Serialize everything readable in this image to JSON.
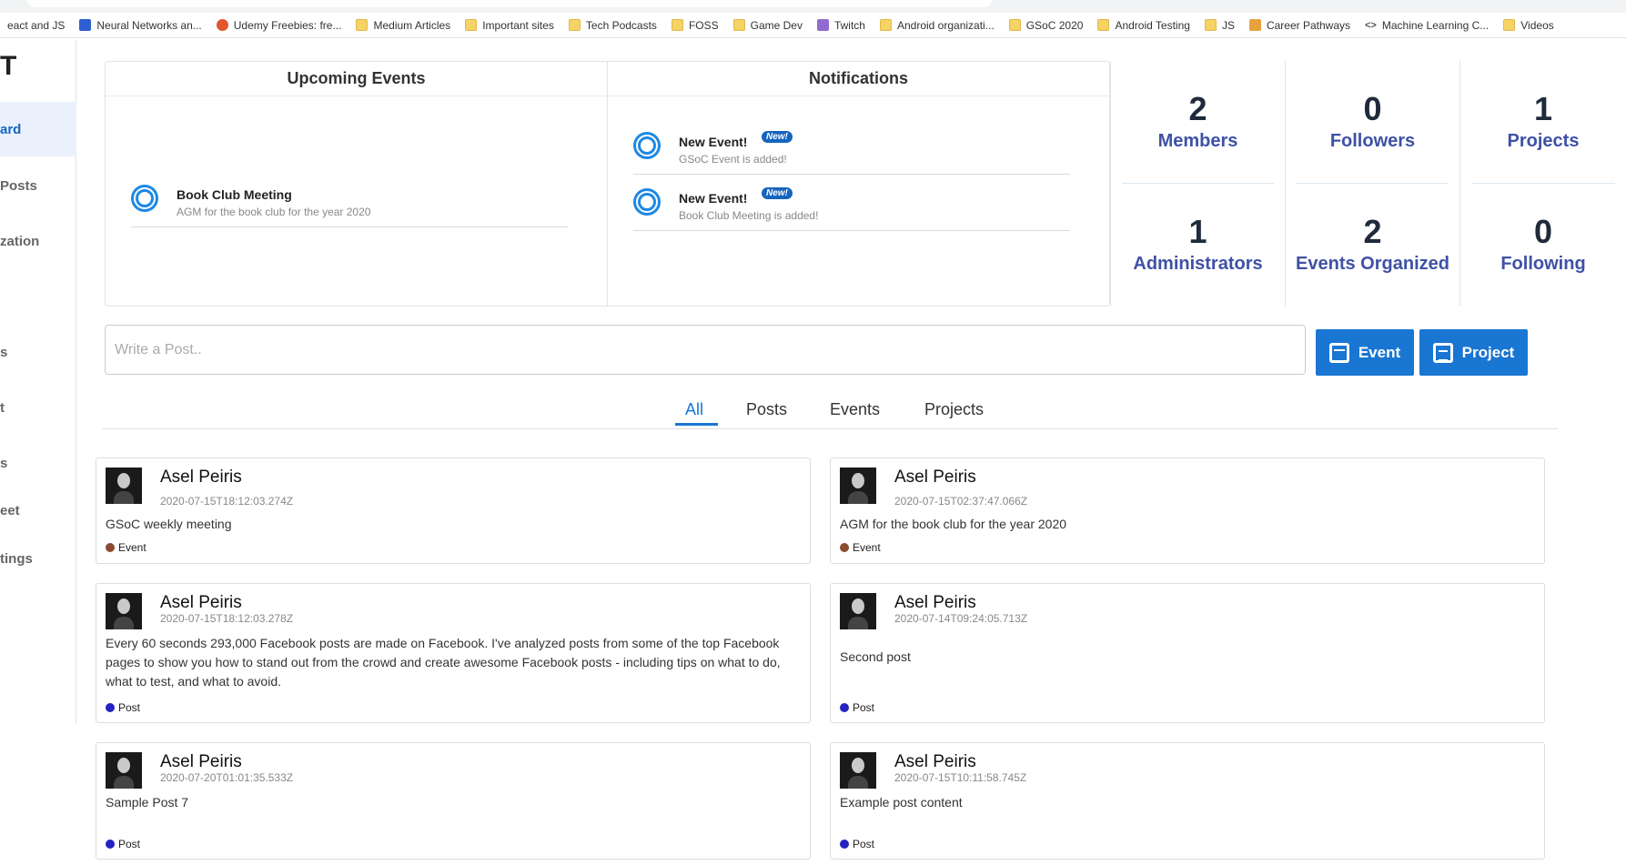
{
  "bookmarks": [
    {
      "label": "eact and JS",
      "icon": "none"
    },
    {
      "label": "Neural Networks an...",
      "icon": "infinity-icon"
    },
    {
      "label": "Udemy Freebies: fre...",
      "icon": "reddit-icon"
    },
    {
      "label": "Medium Articles",
      "icon": "folder-icon"
    },
    {
      "label": "Important sites",
      "icon": "folder-icon"
    },
    {
      "label": "Tech Podcasts",
      "icon": "folder-icon"
    },
    {
      "label": "FOSS",
      "icon": "folder-icon"
    },
    {
      "label": "Game Dev",
      "icon": "folder-icon"
    },
    {
      "label": "Twitch",
      "icon": "twitch-icon"
    },
    {
      "label": "Android organizati...",
      "icon": "folder-icon"
    },
    {
      "label": "GSoC 2020",
      "icon": "folder-icon"
    },
    {
      "label": "Android Testing",
      "icon": "folder-icon"
    },
    {
      "label": "JS",
      "icon": "folder-icon"
    },
    {
      "label": "Career Pathways",
      "icon": "box-icon"
    },
    {
      "label": "Machine Learning C...",
      "icon": "code-icon"
    },
    {
      "label": "Videos",
      "icon": "folder-icon"
    }
  ],
  "sidebar": {
    "logo": "T",
    "items": [
      {
        "label": "ard",
        "active": true
      },
      {
        "label": "Posts",
        "active": false
      },
      {
        "label": "zation",
        "active": false
      },
      {
        "label": "s",
        "active": false
      },
      {
        "label": "t",
        "active": false
      },
      {
        "label": "s",
        "active": false
      },
      {
        "label": "eet",
        "active": false
      },
      {
        "label": "tings",
        "active": false
      }
    ]
  },
  "upcoming": {
    "title": "Upcoming Events",
    "items": [
      {
        "title": "Book Club Meeting",
        "desc": "AGM for the book club for the year 2020"
      }
    ]
  },
  "notifications": {
    "title": "Notifications",
    "badge": "New!",
    "items": [
      {
        "title": "New Event!",
        "desc": "GSoC Event is added!"
      },
      {
        "title": "New Event!",
        "desc": "Book Club Meeting is added!"
      }
    ]
  },
  "stats": [
    {
      "num": "2",
      "label": "Members"
    },
    {
      "num": "0",
      "label": "Followers"
    },
    {
      "num": "1",
      "label": "Projects"
    },
    {
      "num": "1",
      "label": "Administrators"
    },
    {
      "num": "2",
      "label": "Events Organized"
    },
    {
      "num": "0",
      "label": "Following"
    }
  ],
  "composer": {
    "placeholder": "Write a Post..",
    "event_label": "Event",
    "project_label": "Project"
  },
  "tabs": [
    {
      "label": "All",
      "active": true
    },
    {
      "label": "Posts",
      "active": false
    },
    {
      "label": "Events",
      "active": false
    },
    {
      "label": "Projects",
      "active": false
    }
  ],
  "posts": [
    {
      "author": "Asel Peiris",
      "time": "2020-07-15T18:12:03.274Z",
      "body": "GSoC weekly meeting",
      "tag": "Event",
      "tag_color": "#8b4a2f"
    },
    {
      "author": "Asel Peiris",
      "time": "2020-07-15T02:37:47.066Z",
      "body": "AGM for the book club for the year 2020",
      "tag": "Event",
      "tag_color": "#8b4a2f"
    },
    {
      "author": "Asel Peiris",
      "time": "2020-07-15T18:12:03.278Z",
      "body": "Every 60 seconds 293,000 Facebook posts are made on Facebook. I've analyzed posts from some of the top Facebook pages to show you how to stand out from the crowd and create awesome Facebook posts - including tips on what to do, what to test, and what to avoid.",
      "tag": "Post",
      "tag_color": "#2323c0"
    },
    {
      "author": "Asel Peiris",
      "time": "2020-07-14T09:24:05.713Z",
      "body": "Second post",
      "tag": "Post",
      "tag_color": "#2323c0"
    },
    {
      "author": "Asel Peiris",
      "time": "2020-07-20T01:01:35.533Z",
      "body": "Sample Post 7",
      "tag": "Post",
      "tag_color": "#2323c0"
    },
    {
      "author": "Asel Peiris",
      "time": "2020-07-15T10:11:58.745Z",
      "body": "Example post content",
      "tag": "Post",
      "tag_color": "#2323c0"
    }
  ]
}
